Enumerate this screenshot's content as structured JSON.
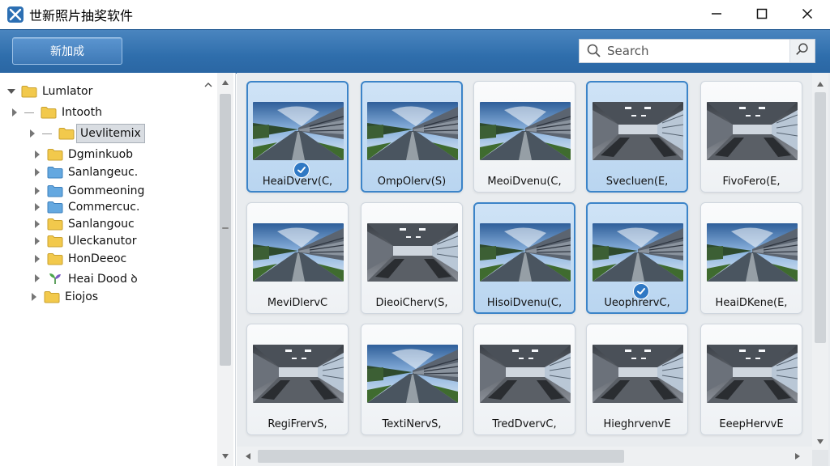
{
  "window": {
    "title": "世新照片抽奖软件",
    "minimize_glyph": "—",
    "maximize_glyph": "☐",
    "close_glyph": "✕"
  },
  "toolbar": {
    "new_button_label": "新加成"
  },
  "search": {
    "placeholder": "Search"
  },
  "tree": {
    "items": [
      {
        "label": "Lumlator",
        "icon": "folder-open-icon",
        "arrow": "chevron-down-icon"
      },
      {
        "label": "Intooth",
        "icon": "folder-icon",
        "arrow": "chevron-right-icon"
      },
      {
        "label": "Uevlitemix",
        "icon": "folder-icon",
        "arrow": "chevron-right-icon",
        "selected": true
      },
      {
        "label": "Dgminkuob",
        "icon": "folder-icon",
        "arrow": "chevron-right-icon"
      },
      {
        "label": "Sanlangeuc.",
        "icon": "folder-blue-icon",
        "arrow": "chevron-right-icon"
      },
      {
        "label": "Gommeoning",
        "icon": "folder-blue-icon",
        "arrow": "chevron-right-icon"
      },
      {
        "label": "Commercuc.",
        "icon": "folder-blue-icon",
        "arrow": "chevron-right-icon"
      },
      {
        "label": "Sanlangouc",
        "icon": "folder-icon",
        "arrow": "chevron-right-icon"
      },
      {
        "label": "Uleckanutor",
        "icon": "folder-icon",
        "arrow": "chevron-right-icon"
      },
      {
        "label": "HonDeeoc",
        "icon": "folder-icon",
        "arrow": "chevron-right-icon"
      },
      {
        "label": "Heai Dood ꝺ",
        "icon": "plant-icon",
        "arrow": "chevron-right-icon"
      },
      {
        "label": "Eiojos",
        "icon": "folder-icon",
        "arrow": "chevron-right-icon"
      }
    ]
  },
  "grid": {
    "tiles": [
      {
        "label": "HeaiDverv(C,",
        "selected": true,
        "checked": true,
        "scene": "outdoor"
      },
      {
        "label": "OmpOlerv(S)",
        "selected": true,
        "checked": false,
        "scene": "outdoor"
      },
      {
        "label": "MeoiDvenu(C,",
        "selected": false,
        "checked": false,
        "scene": "outdoor"
      },
      {
        "label": "Svecluen(E,",
        "selected": true,
        "checked": false,
        "scene": "indoor"
      },
      {
        "label": "FivoFero(E,",
        "selected": false,
        "checked": false,
        "scene": "indoor"
      },
      {
        "label": "MeviDlervC",
        "selected": false,
        "checked": false,
        "scene": "outdoor"
      },
      {
        "label": "DieoiCherv(S,",
        "selected": false,
        "checked": false,
        "scene": "indoor"
      },
      {
        "label": "HisoiDvenu(C,",
        "selected": true,
        "checked": false,
        "scene": "outdoor"
      },
      {
        "label": "UeophrervC,",
        "selected": true,
        "checked": true,
        "scene": "outdoor"
      },
      {
        "label": "HeaiDKene(E,",
        "selected": false,
        "checked": false,
        "scene": "outdoor"
      },
      {
        "label": "RegiFrervS,",
        "selected": false,
        "checked": false,
        "scene": "indoor"
      },
      {
        "label": "TextiNervS,",
        "selected": false,
        "checked": false,
        "scene": "outdoor"
      },
      {
        "label": "TredDvervC,",
        "selected": false,
        "checked": false,
        "scene": "indoor"
      },
      {
        "label": "HieghrvenvE",
        "selected": false,
        "checked": false,
        "scene": "indoor"
      },
      {
        "label": "EeepHervvE",
        "selected": false,
        "checked": false,
        "scene": "indoor"
      }
    ]
  },
  "colors": {
    "toolbar_blue": "#2f6eac",
    "selection_blue": "#3c84c8",
    "check_blue": "#2f78c4",
    "folder_yellow": "#f2c94c",
    "folder_blue": "#64a8e0"
  }
}
